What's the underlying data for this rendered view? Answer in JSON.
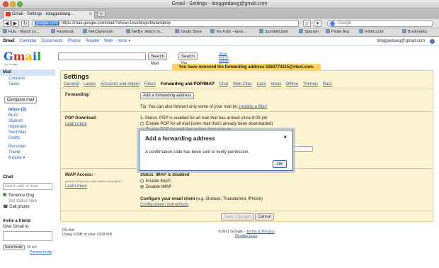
{
  "window": {
    "title": "Gmail - Settings - tdoggiedawg@gmail.com"
  },
  "browser": {
    "tab_title": "Gmail - Settings - tdoggiedawg...",
    "new_tab": "+",
    "site_badge": "google.com",
    "url": "https://mail.google.com/mail/?shva=1#settings/fwdandpop",
    "search_placeholder": "Google",
    "bookmarks": [
      "Hulu - Watch yo...",
      "Facebook",
      "NetClassroom",
      "Netflix: Watch In...",
      "Kindle Store",
      "YouTube - tarvs...",
      "StumbleUpon",
      "Spanish",
      "Pirate Bay",
      "InSECcord"
    ],
    "bookmarks_more": "Bookmarks"
  },
  "gbar": {
    "current": "Gmail",
    "links": [
      "Calendar",
      "Documents",
      "Photos",
      "Reader",
      "Web",
      "more ▾"
    ],
    "account": "tdoggiedawg@gmail.com"
  },
  "logo": {
    "g": "G",
    "m": "m",
    "a": "a",
    "i": "i",
    "l": "l",
    "sub": "by Google"
  },
  "search": {
    "search_mail": "Search Mail",
    "search_web": "Search the Web",
    "options_1": "Show search options",
    "options_2": "Create a filter"
  },
  "notice": "You have removed the forwarding address 5283774115@vtext.com.",
  "nav": {
    "mail": "Mail",
    "contacts": "Contacts",
    "tasks": "Tasks",
    "compose": "Compose mail",
    "labels": [
      "Inbox (3)",
      "Buzz",
      "Starred",
      "Important",
      "Sent Mail",
      "Drafts"
    ],
    "labels2": [
      "Personal",
      "Travel",
      "6 more ▾"
    ]
  },
  "chat": {
    "heading": "Chat",
    "search_placeholder": "Search, add, or invite",
    "me": "Terrence Dog",
    "status": "Set status here",
    "call": "Call phone",
    "invite_heading": "Invite a friend",
    "invite_sub": "Give Gmail to:",
    "send": "Send Invite",
    "left": "50 left",
    "preview": "Preview Invite"
  },
  "settings": {
    "heading": "Settings",
    "tabs": [
      "General",
      "Labels",
      "Accounts and Import",
      "Filters",
      "Forwarding and POP/IMAP",
      "Chat",
      "Web Clips",
      "Labs",
      "Inbox",
      "Offline",
      "Themes",
      "Buzz"
    ],
    "forwarding": {
      "label": "Forwarding:",
      "button": "Add a forwarding address",
      "tip": "Tip: You can also forward only some of your mail by",
      "tip_link": "creating a filter!"
    },
    "pop": {
      "label": "POP Download:",
      "learn": "Learn more",
      "status": "1. Status: POP is enabled for all mail that has arrived since 8:03 pm",
      "opt1": "Enable POP for all mail (even mail that's already been downloaded)",
      "opt2": "Enable POP for mail that arrives from now on"
    },
    "imap": {
      "label": "IMAP Access:",
      "sub": "(access Gmail from other clients using IMAP)",
      "learn": "Learn more",
      "status": "Status: IMAP is disabled",
      "enable": "Enable IMAP",
      "disable": "Disable IMAP",
      "configure": "Configure your email client",
      "configure_rest": "(e.g. Outlook, Thunderbird, iPhone)",
      "instructions": "Configuration instructions"
    },
    "save": "Save Changes",
    "cancel": "Cancel"
  },
  "footer": {
    "usage": "0% full",
    "usage_detail": "Using 0 MB of your 7608 MB",
    "copyright": "©2011 Google -",
    "terms": "Terms & Privacy",
    "disable_buzz": "Disable buzz"
  },
  "dialog": {
    "title": "Add a forwarding address",
    "message": "A confirmation code has been sent to verify permission.",
    "ok": "OK",
    "close": "×"
  }
}
